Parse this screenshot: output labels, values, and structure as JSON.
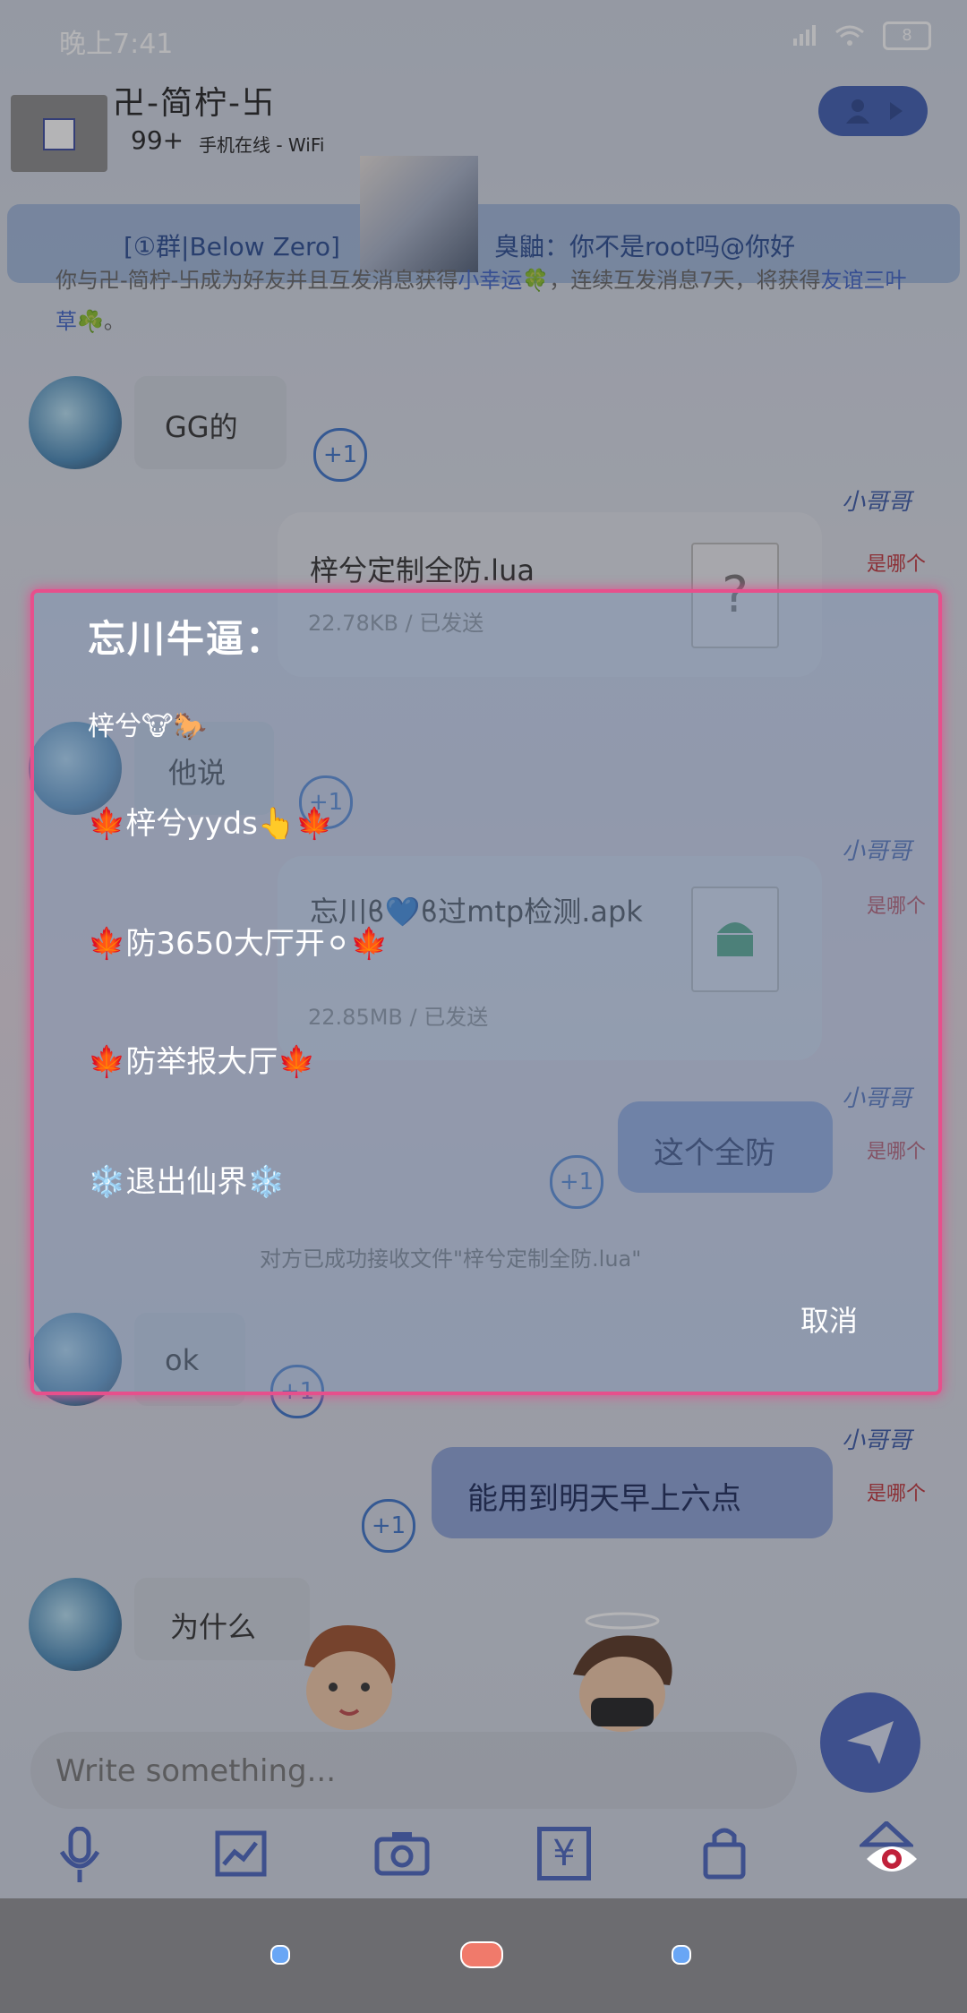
{
  "status_bar": {
    "time": "晚上7:41",
    "battery": "8"
  },
  "header": {
    "contact_name": "卍-简柠-卐",
    "unread_count": "99+",
    "online_status": "手机在线 - WiFi"
  },
  "group_banner": {
    "group": "[①群|Below Zero]",
    "message": "臭鼬：你不是root吗@你好"
  },
  "friend_notice": {
    "prefix": "你与卍-简柠-卐成为好友并且互发消息获得",
    "badge1": "小幸运",
    "middle": "，连续互发消息7天，将获得",
    "badge2": "友谊三叶草",
    "suffix": "。"
  },
  "messages": {
    "m1": "GG的",
    "file1": {
      "name": "梓兮定制全防.lua",
      "size": "22.78KB",
      "status": "已发送",
      "icon": "?"
    },
    "m2": "他说",
    "file2": {
      "name": "忘川ϐ💙ϐ过mtp检测.apk",
      "size": "22.85MB",
      "status": "已发送"
    },
    "m3": "这个全防",
    "received_note": "对方已成功接收文件\"梓兮定制全防.lua\"",
    "m4": "ok",
    "m5": "能用到明天早上六点",
    "m6": "为什么",
    "plus_one": "+1",
    "sticker_top": "小哥哥",
    "sticker_bottom": "是哪个"
  },
  "input": {
    "placeholder": "Write something..."
  },
  "toolbar": {
    "icons": [
      "microphone-icon",
      "image-icon",
      "camera-icon",
      "yen-icon",
      "lock-icon",
      "eye-icon"
    ],
    "yen_glyph": "¥"
  },
  "dialog": {
    "title": "忘川牛逼：",
    "lines": [
      "梓兮🐮🐎",
      "🍁梓兮yyds👆🍁",
      "🍁防3650大厅开⚪🍁",
      "🍁防举报大厅🍁",
      "❄️退出仙界❄️"
    ],
    "cancel_label": "取消"
  },
  "colors": {
    "accent": "#4a66c0",
    "dialog_border": "#e6508c",
    "plus_one": "#3d73c9"
  }
}
